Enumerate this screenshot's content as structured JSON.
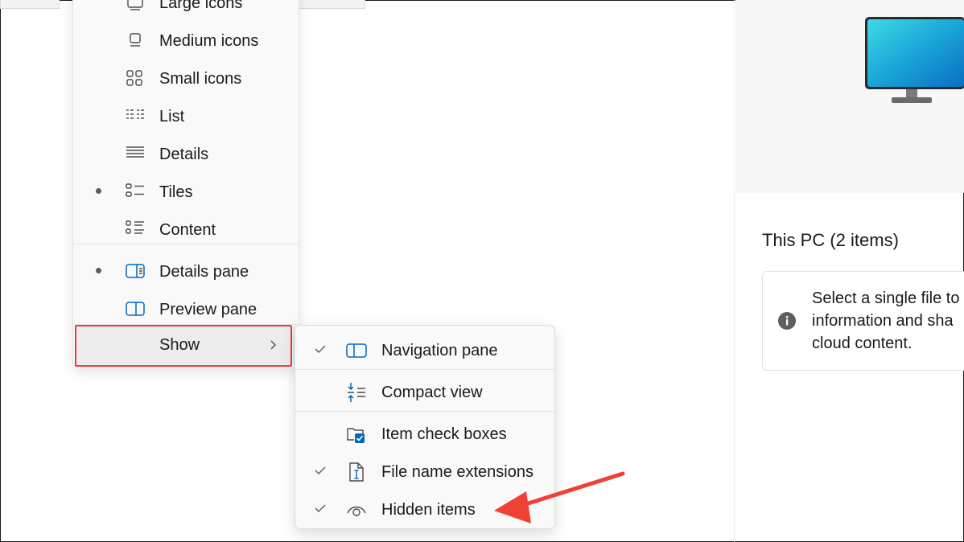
{
  "view_menu": {
    "items": [
      {
        "label": "Large icons",
        "icon": "large-icons-icon",
        "selected": false
      },
      {
        "label": "Medium icons",
        "icon": "medium-icons-icon",
        "selected": false
      },
      {
        "label": "Small icons",
        "icon": "small-icons-icon",
        "selected": false
      },
      {
        "label": "List",
        "icon": "list-icon",
        "selected": false
      },
      {
        "label": "Details",
        "icon": "details-icon",
        "selected": false
      },
      {
        "label": "Tiles",
        "icon": "tiles-icon",
        "selected": true
      },
      {
        "label": "Content",
        "icon": "content-icon",
        "selected": false
      }
    ],
    "panes": [
      {
        "label": "Details pane",
        "icon": "details-pane-icon",
        "selected": true
      },
      {
        "label": "Preview pane",
        "icon": "preview-pane-icon",
        "selected": false
      }
    ],
    "show_label": "Show"
  },
  "show_submenu": {
    "items": [
      {
        "label": "Navigation pane",
        "icon": "navigation-pane-icon",
        "checked": true
      },
      {
        "label": "Compact view",
        "icon": "compact-view-icon",
        "checked": false
      },
      {
        "label": "Item check boxes",
        "icon": "item-check-boxes-icon",
        "checked": false
      },
      {
        "label": "File name extensions",
        "icon": "file-name-extensions-icon",
        "checked": true
      },
      {
        "label": "Hidden items",
        "icon": "eye-icon",
        "checked": true
      }
    ]
  },
  "details_pane": {
    "title": "This PC (2 items)",
    "info_lines": [
      "Select a single file to",
      "information and sha",
      "cloud content."
    ]
  },
  "colors": {
    "accent": "#0067c0",
    "highlight": "#e8413b",
    "arrow": "#ef4136"
  }
}
